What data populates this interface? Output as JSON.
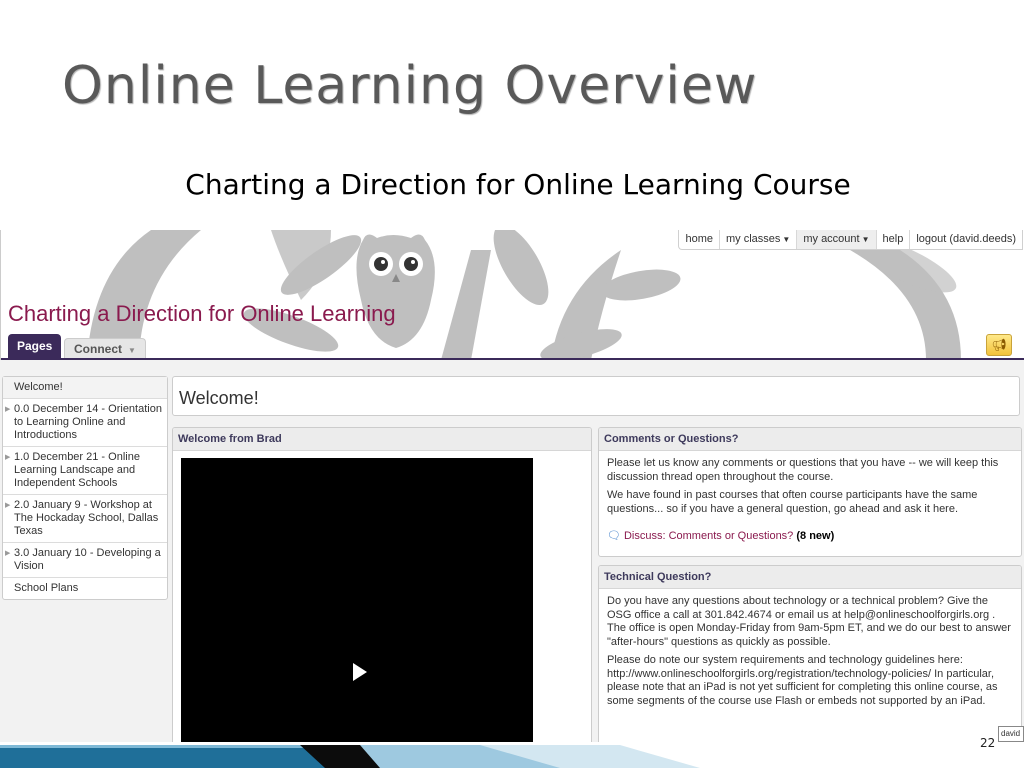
{
  "slide": {
    "title": "Online Learning Overview",
    "subtitle": "Charting a Direction for Online Learning Course",
    "page_number": "22"
  },
  "topnav": {
    "items": [
      "home",
      "my classes",
      "my account",
      "help",
      "logout (david.deeds)"
    ]
  },
  "site_title": "Charting a Direction for Online Learning",
  "tabs": {
    "pages": "Pages",
    "connect": "Connect"
  },
  "sidebar": {
    "items": [
      "Welcome!",
      "0.0 December 14 - Orientation to Learning Online and Introductions",
      "1.0 December 21 - Online Learning Landscape and Independent Schools",
      "2.0 January 9 - Workshop at The Hockaday School, Dallas Texas",
      "3.0 January 10 - Developing a Vision",
      "School Plans"
    ]
  },
  "welcome_heading": "Welcome!",
  "brad_panel": {
    "title": "Welcome from Brad"
  },
  "comments_panel": {
    "title": "Comments or Questions?",
    "p1": "Please let us know any comments or questions that you have -- we will keep this discussion thread open throughout the course.",
    "p2": "We have found in past courses that often course participants have the same questions... so if you have a general question, go ahead and ask it here.",
    "link": "Discuss: Comments or Questions?",
    "count": "(8 new)"
  },
  "tech_panel": {
    "title": "Technical Question?",
    "p1": "Do you have any questions about technology or a technical problem? Give the OSG office a call at 301.842.4674 or email us at help@onlineschoolforgirls.org . The office is open Monday-Friday from 9am-5pm ET, and we do our best to answer \"after-hours\" questions as quickly as possible.",
    "p2": "Please do note our system requirements and technology guidelines here: http://www.onlineschoolforgirls.org/registration/technology-policies/ In particular, please note that an iPad is not yet sufficient for completing this online course, as some segments of the course use Flash or embeds not supported by an iPad."
  },
  "user_tag": "david",
  "colors": {
    "accent_purple": "#3b2a5a",
    "title_maroon": "#8a1a4e",
    "panel_header_text": "#3e3a5c"
  }
}
